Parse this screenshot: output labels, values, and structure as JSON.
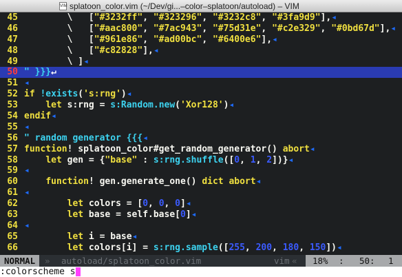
{
  "window": {
    "title": "splatoon_color.vim (~/Dev/gi...–color–splatoon/autoload) – VIM",
    "doc_icon_label": "VIM"
  },
  "lines": [
    {
      "num": "45",
      "html": "        \\   [\"#3232ff\", \"#323296\", \"#3232c8\", \"#3fa9d9\"],"
    },
    {
      "num": "46",
      "html": "        \\   [\"#aac800\", \"#7ac943\", \"#75d31e\", \"#c2e329\", \"#0bd67d\"],"
    },
    {
      "num": "47",
      "html": "        \\   [\"#961e86\", \"#ad00bc\", \"#6400e6\"],"
    },
    {
      "num": "48",
      "html": "        \\   [\"#c82828\"],"
    },
    {
      "num": "49",
      "html": "        \\ ]"
    },
    {
      "num": "50",
      "html": "\" }}}"
    },
    {
      "num": "51",
      "html": ""
    },
    {
      "num": "52",
      "html": "if !exists('s:rng')"
    },
    {
      "num": "53",
      "html": "    let s:rng = s:Random.new('Xor128')"
    },
    {
      "num": "54",
      "html": "endif"
    },
    {
      "num": "55",
      "html": ""
    },
    {
      "num": "56",
      "html": "\" random generator {{{"
    },
    {
      "num": "57",
      "html": "function! splatoon_color#get_random_generator() abort"
    },
    {
      "num": "58",
      "html": "    let gen = {\"base\" : s:rng.shuffle([0, 1, 2])}"
    },
    {
      "num": "59",
      "html": ""
    },
    {
      "num": "60",
      "html": "    function! gen.generate_one() dict abort"
    },
    {
      "num": "61",
      "html": ""
    },
    {
      "num": "62",
      "html": "        let colors = [0, 0, 0]"
    },
    {
      "num": "63",
      "html": "        let base = self.base[0]"
    },
    {
      "num": "64",
      "html": ""
    },
    {
      "num": "65",
      "html": "        let i = base"
    },
    {
      "num": "66",
      "html": "        let colors[i] = s:rng.sample([255, 200, 180, 150])"
    }
  ],
  "status": {
    "mode": "NORMAL",
    "sep_left": "»",
    "filename": "autoload/splatoon_color.vim",
    "filetype": "vim",
    "sep_right": "«",
    "percent": "18%",
    "colon": ":",
    "line": "50:",
    "col": "1"
  },
  "cmdline": {
    "text": ":colorscheme s"
  },
  "colors": {
    "background": "#1d1f21",
    "line_number": "#f0e040",
    "current_line_bg": "#2a3bb3",
    "string": "#f0e040",
    "comment": "#3dd3f0",
    "number": "#3b5bff",
    "eol_marker": "#1e6cff",
    "cursor": "#ff40ff"
  }
}
